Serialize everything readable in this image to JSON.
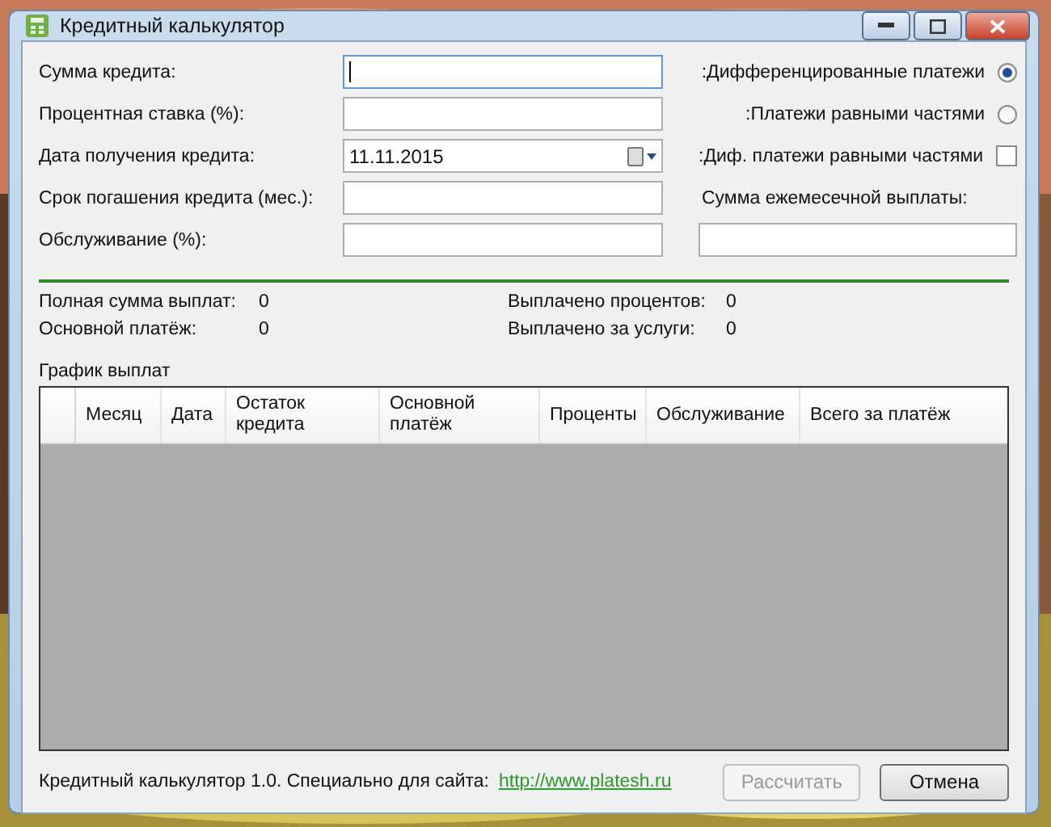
{
  "window": {
    "title": "Кредитный калькулятор"
  },
  "fields": [
    {
      "label": "Сумма кредита:",
      "kind": "text",
      "focused": true
    },
    {
      "label": "Процентная ставка (%):",
      "kind": "text",
      "focused": false
    },
    {
      "label": "Дата получения кредита:",
      "value": "11.11.2015",
      "kind": "date",
      "focused": false
    },
    {
      "label": "Срок погашения кредита (мес.):",
      "kind": "text",
      "focused": false
    },
    {
      "label": "Обслуживание (%):",
      "kind": "text",
      "focused": false
    }
  ],
  "options": [
    {
      "label": ":Дифференцированные платежи",
      "kind": "radio",
      "selected": true
    },
    {
      "label": ":Платежи равными частями",
      "kind": "radio",
      "selected": false
    },
    {
      "label": ":Диф. платежи равными частями",
      "kind": "checkbox",
      "selected": false
    }
  ],
  "monthly_payment": {
    "label": "Сумма ежемесечной выплаты:"
  },
  "summary": [
    {
      "label": "Полная сумма выплат:",
      "value": "0"
    },
    {
      "label": "Выплачено процентов:",
      "value": "0"
    },
    {
      "label": "Основной платёж:",
      "value": "0"
    },
    {
      "label": "Выплачено за услуги:",
      "value": "0"
    }
  ],
  "schedule": {
    "title": "График выплат",
    "columns": [
      "Месяц",
      "Дата",
      "Остаток кредита",
      "Основной платёж",
      "Проценты",
      "Обслуживание",
      "Всего за платёж"
    ]
  },
  "footer": {
    "text": "Кредитный калькулятор 1.0. Специально для сайта:",
    "link": "http://www.platesh.ru"
  },
  "buttons": [
    {
      "label": "Рассчитать",
      "disabled": true
    },
    {
      "label": "Отмена",
      "disabled": false
    }
  ]
}
